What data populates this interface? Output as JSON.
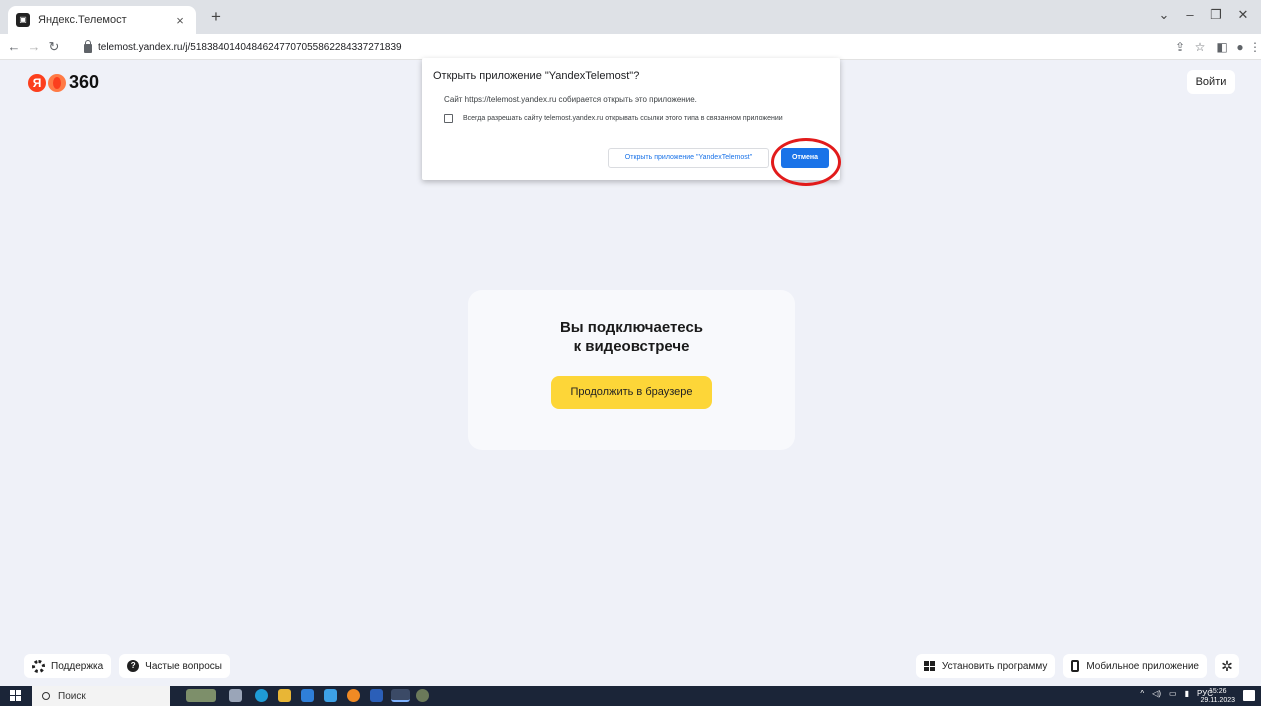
{
  "browser": {
    "tab_title": "Яндекс.Телемост",
    "tab_close": "×",
    "new_tab": "+",
    "url_host": "telemost.yandex.ru",
    "url_path": "/j/51838401404846247707055862284337271839"
  },
  "page": {
    "logo_text": "360",
    "login_label": "Войти",
    "card_title_line1": "Вы подключаетесь",
    "card_title_line2": "к видеовстрече",
    "continue_label": "Продолжить в браузере"
  },
  "dialog": {
    "title": "Открыть приложение \"YandexTelemost\"?",
    "text": "Сайт https://telemost.yandex.ru собирается открыть это приложение.",
    "checkbox_label": "Всегда разрешать сайту telemost.yandex.ru открывать ссылки этого типа в связанном приложении",
    "open_label": "Открыть приложение \"YandexTelemost\"",
    "cancel_label": "Отмена"
  },
  "footer": {
    "support_label": "Поддержка",
    "faq_label": "Частые вопросы",
    "install_label": "Установить программу",
    "mobile_label": "Мобильное приложение"
  },
  "taskbar": {
    "search_placeholder": "Поиск",
    "lang": "РУС",
    "time": "15:26",
    "date": "29.11.2023"
  },
  "colors": {
    "accent_blue": "#1a73e8",
    "yellow_button": "#fdd638",
    "highlight_red": "#e21b1b",
    "page_bg": "#eff1f8"
  }
}
